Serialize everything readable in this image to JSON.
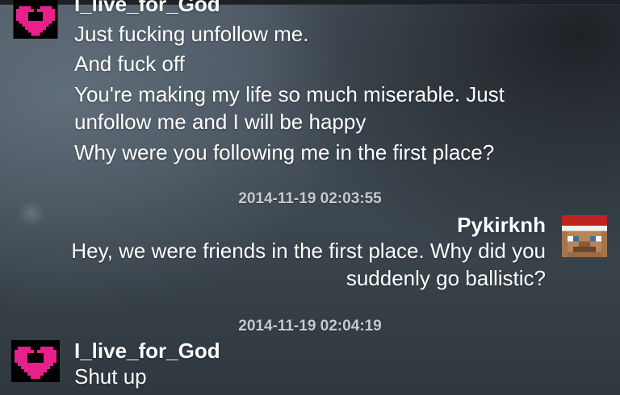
{
  "chat": {
    "block1": {
      "sender": "I_live_for_God",
      "messages": [
        "Just fucking unfollow me.",
        "And fuck off",
        "You're making my life so much miserable. Just unfollow me and I will be happy",
        "Why were you following me in the first place?"
      ]
    },
    "timestamp1": "2014-11-19 02:03:55",
    "block2": {
      "sender": "Pykirknh",
      "messages": [
        "Hey, we were friends in the first place. Why did you suddenly go ballistic?"
      ]
    },
    "timestamp2": "2014-11-19 02:04:19",
    "block3": {
      "sender": "I_live_for_God",
      "messages": [
        "Shut up"
      ]
    }
  },
  "avatars": {
    "heart_color": "#e8208a",
    "heart_icon": "pixel-heart-icon",
    "player_icon": "minecraft-santa-head-icon"
  }
}
